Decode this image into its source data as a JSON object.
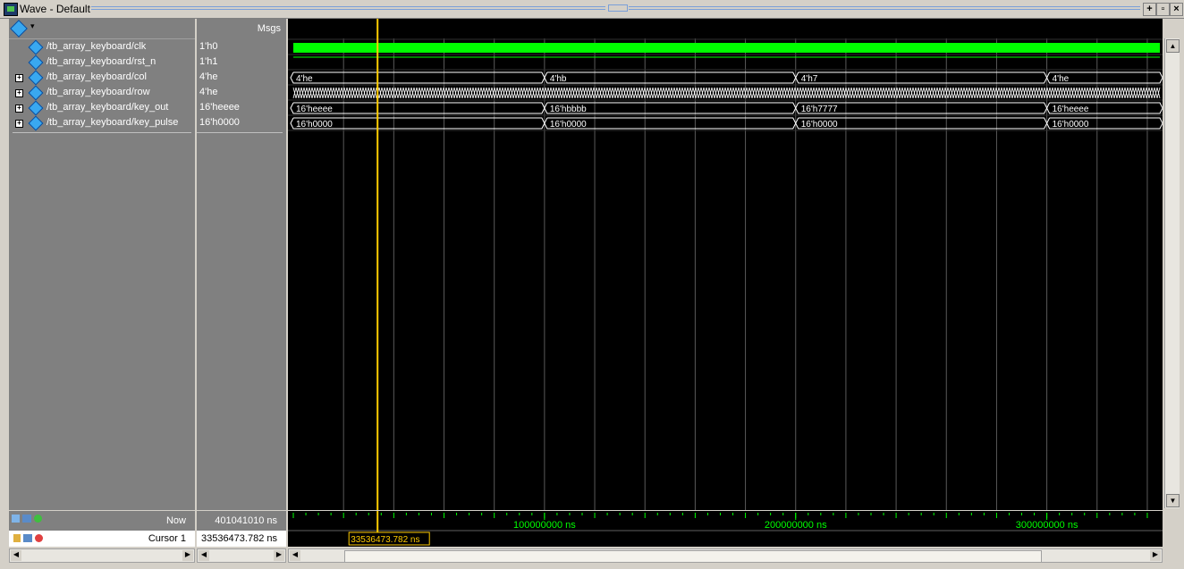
{
  "window": {
    "title": "Wave - Default"
  },
  "header": {
    "msgs_label": "Msgs"
  },
  "signals": [
    {
      "name": "/tb_array_keyboard/clk",
      "value": "1'h0",
      "expandable": false
    },
    {
      "name": "/tb_array_keyboard/rst_n",
      "value": "1'h1",
      "expandable": false
    },
    {
      "name": "/tb_array_keyboard/col",
      "value": "4'he",
      "expandable": true
    },
    {
      "name": "/tb_array_keyboard/row",
      "value": "4'he",
      "expandable": true
    },
    {
      "name": "/tb_array_keyboard/key_out",
      "value": "16'heeee",
      "expandable": true
    },
    {
      "name": "/tb_array_keyboard/key_pulse",
      "value": "16'h0000",
      "expandable": true
    }
  ],
  "waves": {
    "col_labels": [
      "4'he",
      "4'hb",
      "4'h7",
      "4'he"
    ],
    "key_out_labels": [
      "16'heeee",
      "16'hbbbb",
      "16'h7777",
      "16'heeee"
    ],
    "key_pulse_labels": [
      "16'h0000",
      "16'h0000",
      "16'h0000",
      "16'h0000"
    ],
    "signal_color": "#00ff00",
    "bus_color": "#ffffff",
    "cursor_color": "#ffcc00"
  },
  "timeline": {
    "unit": "ns",
    "ticks": [
      "100000000 ns",
      "200000000 ns",
      "300000000 ns"
    ],
    "tick_values": [
      100000000,
      200000000,
      300000000
    ],
    "now_label": "Now",
    "now_value": "401041010 ns",
    "cursor_label": "Cursor 1",
    "cursor_value": "33536473.782 ns",
    "cursor_time": 33536473.782,
    "cursor_box": "33536473.782 ns"
  },
  "icons": {
    "toolbar": "diamond-signal-icon",
    "now_tools": [
      "add-wave-icon",
      "zoom-icon",
      "plus-circle-icon"
    ],
    "cursor_tools": [
      "lock-icon",
      "pen-icon",
      "remove-cursor-icon"
    ]
  }
}
